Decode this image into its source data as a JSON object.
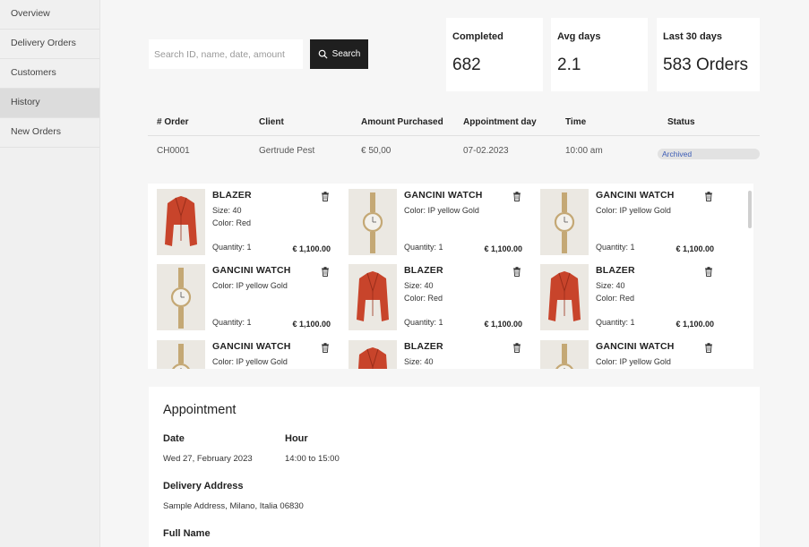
{
  "sidebar": {
    "items": [
      "Overview",
      "Delivery Orders",
      "Customers",
      "History",
      "New Orders"
    ],
    "active": "History"
  },
  "search": {
    "placeholder": "Search ID, name, date, amount",
    "button_label": "Search"
  },
  "stats": [
    {
      "label": "Completed",
      "value": "682"
    },
    {
      "label": "Avg days",
      "value": "2.1"
    },
    {
      "label": "Last 30 days",
      "value": "583 Orders"
    }
  ],
  "table": {
    "headers": [
      "# Order",
      "Client",
      "Amount Purchased",
      "Appointment day",
      "Time",
      "Status"
    ],
    "row": {
      "order": "CH0001",
      "client": "Gertrude Pest",
      "amount": "€ 50,00",
      "day": "07-02.2023",
      "time": "10:00 am",
      "status": "Archived"
    }
  },
  "products": [
    {
      "name": "BLAZER",
      "size": "Size: 40",
      "color": "Color: Red",
      "quantity": "Quantity: 1",
      "price": "€ 1,100.00",
      "icon": "blazer-icon"
    },
    {
      "name": "GANCINI WATCH",
      "size": "",
      "color": "Color: IP yellow Gold",
      "quantity": "Quantity: 1",
      "price": "€ 1,100.00",
      "icon": "watch-icon"
    },
    {
      "name": "GANCINI WATCH",
      "size": "",
      "color": "Color: IP yellow Gold",
      "quantity": "Quantity: 1",
      "price": "€ 1,100.00",
      "icon": "watch-icon"
    },
    {
      "name": "GANCINI WATCH",
      "size": "",
      "color": "Color: IP yellow Gold",
      "quantity": "Quantity: 1",
      "price": "€ 1,100.00",
      "icon": "watch-icon"
    },
    {
      "name": "BLAZER",
      "size": "Size: 40",
      "color": "Color: Red",
      "quantity": "Quantity: 1",
      "price": "€ 1,100.00",
      "icon": "blazer-icon"
    },
    {
      "name": "BLAZER",
      "size": "Size: 40",
      "color": "Color: Red",
      "quantity": "Quantity: 1",
      "price": "€ 1,100.00",
      "icon": "blazer-icon"
    },
    {
      "name": "GANCINI WATCH",
      "size": "",
      "color": "Color: IP yellow Gold",
      "quantity": "",
      "price": "",
      "icon": "watch-icon"
    },
    {
      "name": "BLAZER",
      "size": "Size: 40",
      "color": "",
      "quantity": "",
      "price": "",
      "icon": "blazer-icon"
    },
    {
      "name": "GANCINI WATCH",
      "size": "",
      "color": "Color: IP yellow Gold",
      "quantity": "",
      "price": "",
      "icon": "watch-icon"
    }
  ],
  "appointment": {
    "title": "Appointment",
    "date_label": "Date",
    "date_value": "Wed 27, February 2023",
    "hour_label": "Hour",
    "hour_value": "14:00 to 15:00",
    "address_label": "Delivery Address",
    "address_value": "Sample Address, Milano, Italia 06830",
    "name_label": "Full Name"
  },
  "colors": {
    "blazer": "#c8442b",
    "watch_gold": "#c4a875",
    "status_text": "#3b5bb5",
    "button_bg": "#1f1f1f"
  }
}
